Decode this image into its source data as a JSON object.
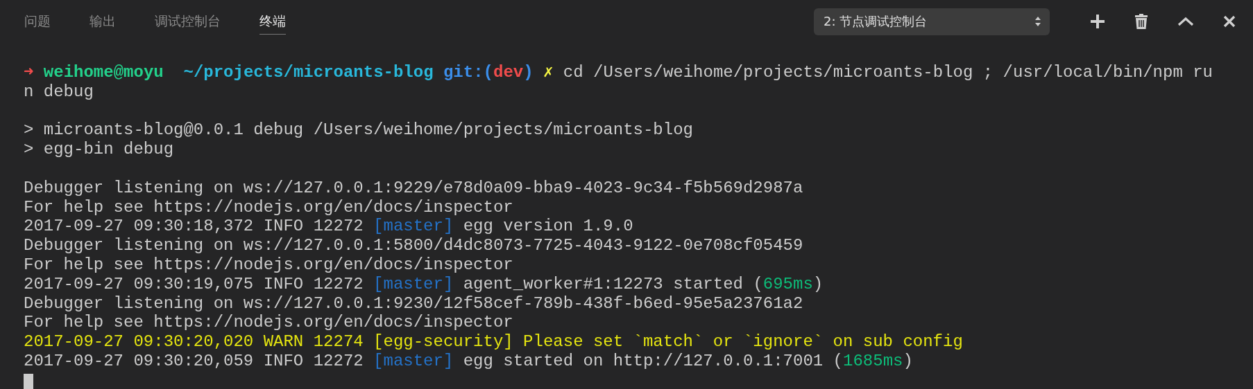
{
  "tabs": [
    {
      "label": "问题",
      "selected": false
    },
    {
      "label": "输出",
      "selected": false
    },
    {
      "label": "调试控制台",
      "selected": false
    },
    {
      "label": "终端",
      "selected": true
    }
  ],
  "terminal_select": {
    "value": "2: 节点调试控制台"
  },
  "terminal": {
    "blocks": [
      {
        "lines": [
          [
            {
              "text": "➜",
              "kind": "arrow"
            },
            {
              "text": " weihome@moyu",
              "kind": "user"
            },
            {
              "text": "  ~/projects/microants-blog",
              "kind": "path"
            },
            {
              "text": " git:(",
              "kind": "git"
            },
            {
              "text": "dev",
              "kind": "branch"
            },
            {
              "text": ")",
              "kind": "git"
            },
            {
              "text": " ✗",
              "kind": "dirty"
            },
            {
              "text": " cd /Users/weihome/projects/microants-blog ; /usr/local/bin/npm ru"
            }
          ],
          [
            {
              "text": "n debug"
            }
          ]
        ]
      },
      {
        "lines": [
          [
            {
              "text": "> microants-blog@0.0.1 debug /Users/weihome/projects/microants-blog"
            }
          ],
          [
            {
              "text": "> egg-bin debug"
            }
          ]
        ]
      },
      {
        "lines": [
          [
            {
              "text": "Debugger listening on ws://127.0.0.1:9229/e78d0a09-bba9-4023-9c34-f5b569d2987a"
            }
          ],
          [
            {
              "text": "For help see https://nodejs.org/en/docs/inspector"
            }
          ],
          [
            {
              "text": "2017-09-27 09:30:18,372 INFO 12272 "
            },
            {
              "text": "[master]",
              "kind": "tag"
            },
            {
              "text": " egg version 1.9.0"
            }
          ],
          [
            {
              "text": "Debugger listening on ws://127.0.0.1:5800/d4dc8073-7725-4043-9122-0e708cf05459"
            }
          ],
          [
            {
              "text": "For help see https://nodejs.org/en/docs/inspector"
            }
          ],
          [
            {
              "text": "2017-09-27 09:30:19,075 INFO 12272 "
            },
            {
              "text": "[master]",
              "kind": "tag"
            },
            {
              "text": " agent_worker#1:12273 started ("
            },
            {
              "text": "695ms",
              "kind": "time"
            },
            {
              "text": ")"
            }
          ],
          [
            {
              "text": "Debugger listening on ws://127.0.0.1:9230/12f58cef-789b-438f-b6ed-95e5a23761a2"
            }
          ],
          [
            {
              "text": "For help see https://nodejs.org/en/docs/inspector"
            }
          ],
          [
            {
              "text": "2017-09-27 09:30:20,020 WARN 12274 [egg-security] Please set `match` or `ignore` on sub config",
              "kind": "warn"
            }
          ],
          [
            {
              "text": "2017-09-27 09:30:20,059 INFO 12272 "
            },
            {
              "text": "[master]",
              "kind": "tag"
            },
            {
              "text": " egg started on http://127.0.0.1:7001 ("
            },
            {
              "text": "1685ms",
              "kind": "time"
            },
            {
              "text": ")"
            }
          ]
        ]
      }
    ]
  }
}
